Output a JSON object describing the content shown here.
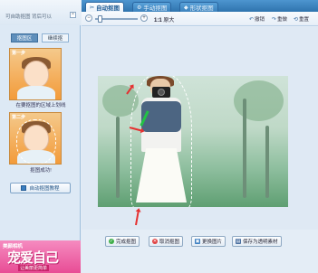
{
  "tabs": [
    {
      "label": "自动抠图",
      "icon": "scissors-icon",
      "active": true
    },
    {
      "label": "手动抠图",
      "icon": "gear-icon",
      "active": false
    },
    {
      "label": "形状抠图",
      "icon": "shape-icon",
      "active": false
    }
  ],
  "left": {
    "hint": "可自助抠图 背后可以",
    "subtabs": [
      "抠图区",
      "继续抠"
    ],
    "examples": [
      {
        "tag": "第一步",
        "caption": "在要抠图的区域上划线"
      },
      {
        "tag": "第二步",
        "caption": "抠图成功!"
      }
    ],
    "tutorial_label": "自动抠图教程",
    "ad": {
      "header": "美颜相机",
      "big": "宠爱自己",
      "sub": "让美丽更简单"
    }
  },
  "toolbar": {
    "orig_ratio": "1:1",
    "orig_label": "原大",
    "undo": "撤销",
    "redo": "重做",
    "reset": "重置"
  },
  "bottom": {
    "done": "完成抠图",
    "cancel": "取消抠图",
    "replace": "更换图片",
    "save": "保存为透明素材"
  }
}
